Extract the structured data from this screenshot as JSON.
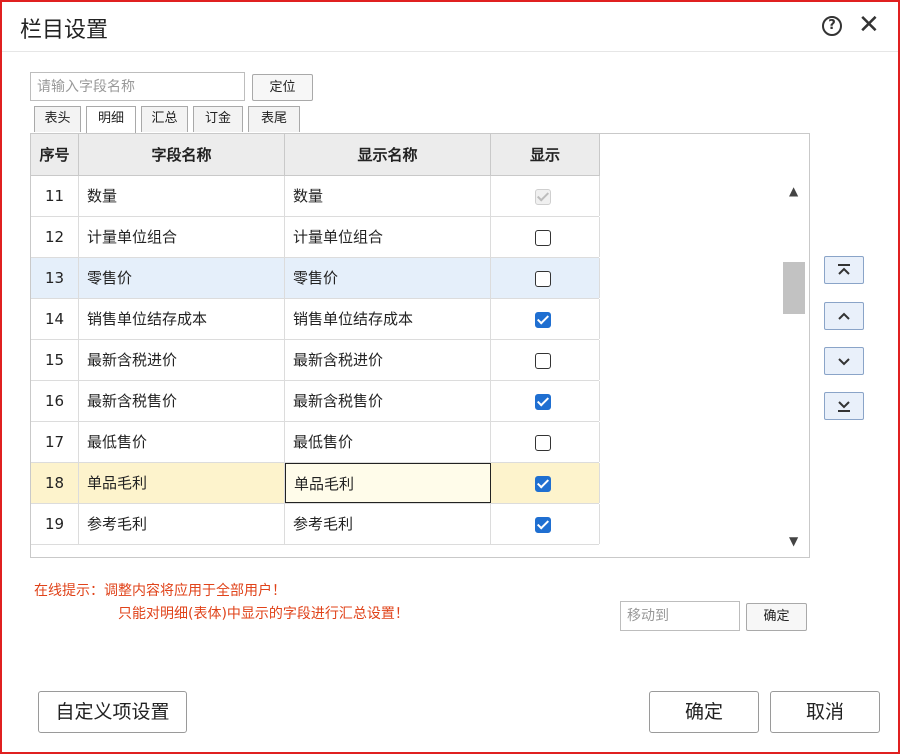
{
  "dialog": {
    "title": "栏目设置",
    "help_icon": "?",
    "close_icon": "✕"
  },
  "search": {
    "placeholder": "请输入字段名称",
    "locate_label": "定位"
  },
  "tabs": [
    "表头",
    "明细",
    "汇总",
    "订金",
    "表尾"
  ],
  "active_tab": "明细",
  "table": {
    "headers": {
      "no": "序号",
      "field": "字段名称",
      "display": "显示名称",
      "show": "显示"
    },
    "rows": [
      {
        "no": "11",
        "field": "数量",
        "display": "数量",
        "show": "disabled"
      },
      {
        "no": "12",
        "field": "计量单位组合",
        "display": "计量单位组合",
        "show": false
      },
      {
        "no": "13",
        "field": "零售价",
        "display": "零售价",
        "show": false
      },
      {
        "no": "14",
        "field": "销售单位结存成本",
        "display": "销售单位结存成本",
        "show": true
      },
      {
        "no": "15",
        "field": "最新含税进价",
        "display": "最新含税进价",
        "show": false
      },
      {
        "no": "16",
        "field": "最新含税售价",
        "display": "最新含税售价",
        "show": true
      },
      {
        "no": "17",
        "field": "最低售价",
        "display": "最低售价",
        "show": false
      },
      {
        "no": "18",
        "field": "单品毛利",
        "display": "单品毛利",
        "show": true
      },
      {
        "no": "19",
        "field": "参考毛利",
        "display": "参考毛利",
        "show": true
      }
    ],
    "scroll_up_icon": "▲",
    "scroll_down_icon": "▼"
  },
  "side_buttons": [
    "move-top-icon",
    "move-up-icon",
    "move-down-icon",
    "move-bottom-icon"
  ],
  "tips": {
    "line1": "在线提示：调整内容将应用于全部用户！",
    "line2": "只能对明细(表体)中显示的字段进行汇总设置！"
  },
  "move": {
    "placeholder": "移动到",
    "ok_label": "确定"
  },
  "footer": {
    "custom_label": "自定义项设置",
    "ok_label": "确定",
    "cancel_label": "取消"
  },
  "colors": {
    "border": "#e02020",
    "tip": "#e0431a",
    "check": "#1f6fd1",
    "row_highlight_blue": "#e5effa",
    "row_highlight_yellow": "#fdf3cc"
  }
}
